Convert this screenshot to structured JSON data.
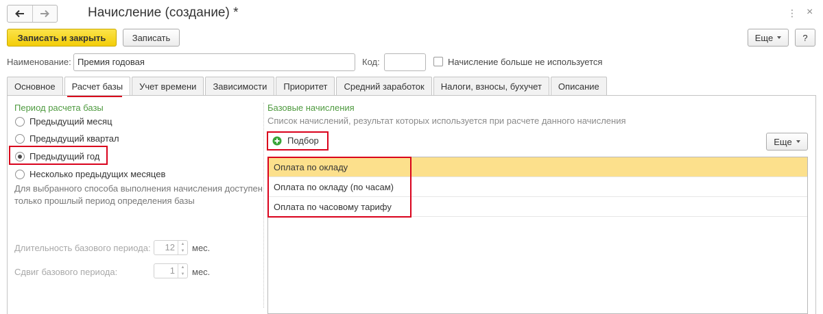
{
  "window": {
    "title": "Начисление (создание) *"
  },
  "toolbar": {
    "save_close_label": "Записать и закрыть",
    "save_label": "Записать",
    "more_label": "Еще",
    "help_label": "?"
  },
  "form": {
    "name_label": "Наименование:",
    "name_value": "Премия годовая",
    "code_label": "Код:",
    "code_value": "",
    "unused_label": "Начисление больше не используется"
  },
  "tabs": [
    {
      "label": "Основное"
    },
    {
      "label": "Расчет базы"
    },
    {
      "label": "Учет времени"
    },
    {
      "label": "Зависимости"
    },
    {
      "label": "Приоритет"
    },
    {
      "label": "Средний заработок"
    },
    {
      "label": "Налоги, взносы, бухучет"
    },
    {
      "label": "Описание"
    }
  ],
  "active_tab": "Расчет базы",
  "period": {
    "title": "Период расчета базы",
    "options": [
      {
        "label": "Предыдущий месяц",
        "selected": false
      },
      {
        "label": "Предыдущий квартал",
        "selected": false
      },
      {
        "label": "Предыдущий год",
        "selected": true
      },
      {
        "label": "Несколько предыдущих месяцев",
        "selected": false
      }
    ],
    "hint": "Для выбранного способа выполнения начисления доступен только прошлый период определения базы",
    "duration_label": "Длительность базового периода:",
    "duration_value": "12",
    "duration_unit": "мес.",
    "shift_label": "Сдвиг базового периода:",
    "shift_value": "1",
    "shift_unit": "мес."
  },
  "base": {
    "title": "Базовые начисления",
    "description": "Список начислений, результат которых используется при расчете данного начисления",
    "pick_label": "Подбор",
    "more_label": "Еще",
    "items": [
      {
        "label": "Оплата по окладу",
        "selected": true
      },
      {
        "label": "Оплата по окладу (по часам)",
        "selected": false
      },
      {
        "label": "Оплата по часовому тарифу",
        "selected": false
      }
    ]
  },
  "colors": {
    "accent_yellow": "#f5d116",
    "selection": "#fce08c",
    "section_green": "#4e9a3f",
    "highlight_red": "#d9001b",
    "plus_green": "#3aa53a"
  },
  "icons": {
    "back": "arrow-left-icon",
    "forward": "arrow-right-icon",
    "menu": "kebab-icon",
    "close": "close-icon",
    "add": "plus-circle-icon"
  }
}
